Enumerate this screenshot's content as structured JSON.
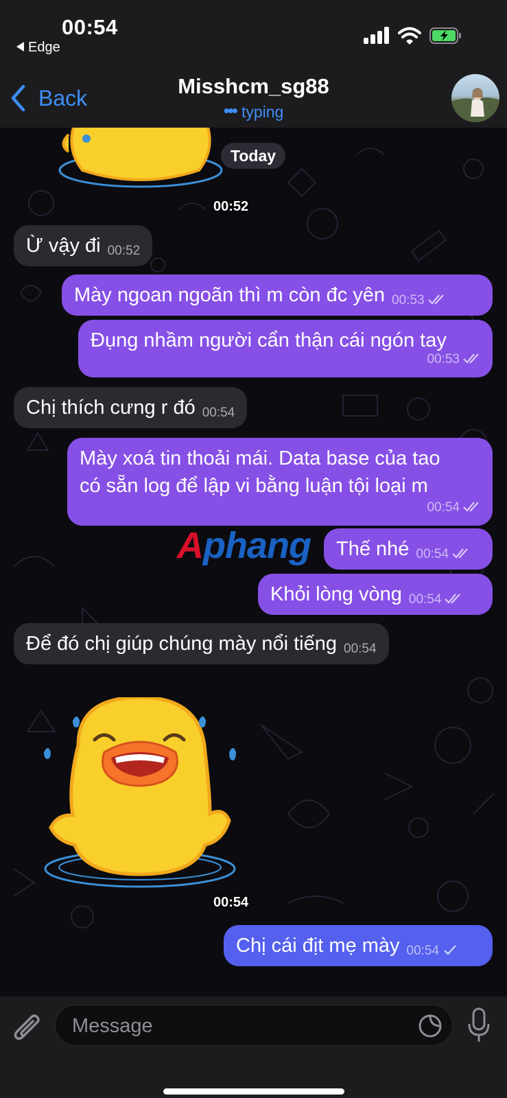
{
  "status_bar": {
    "time": "00:54",
    "back_app": "Edge"
  },
  "nav": {
    "back_label": "Back",
    "title": "Misshcm_sg88",
    "status": "typing"
  },
  "chat": {
    "date_label": "Today",
    "sticker1_time": "00:52",
    "sticker2_time": "00:54",
    "watermark": {
      "part1": "A",
      "part2": "phang"
    },
    "messages": [
      {
        "dir": "in",
        "text": "Ừ vậy đi",
        "time": "00:52"
      },
      {
        "dir": "out",
        "text": "Mày ngoan ngoãn thì m còn đc yên",
        "time": "00:53"
      },
      {
        "dir": "out",
        "text": "Đụng nhầm người cẩn thận cái ngón tay",
        "time": "00:53"
      },
      {
        "dir": "in",
        "text": "Chị thích cưng r đó",
        "time": "00:54"
      },
      {
        "dir": "out",
        "line1": "Mày xoá tin thoải mái. Data base của tao",
        "line2": "có sẵn log để lập vi bằng luận tội loại m",
        "time": "00:54"
      },
      {
        "dir": "out",
        "text": "Thế nhé",
        "time": "00:54"
      },
      {
        "dir": "out",
        "text": "Khỏi lòng vòng",
        "time": "00:54"
      },
      {
        "dir": "in",
        "text": "Để đó chị giúp chúng mày nổi tiếng",
        "time": "00:54"
      },
      {
        "dir": "out",
        "text": "Chị cái địt mẹ mày",
        "time": "00:54"
      }
    ]
  },
  "input": {
    "placeholder": "Message"
  },
  "colors": {
    "outgoing_bubble": "#8650e6",
    "outgoing_last_bubble": "#5560ee",
    "incoming_bubble": "#2b2a30",
    "accent": "#3e8ef7"
  }
}
